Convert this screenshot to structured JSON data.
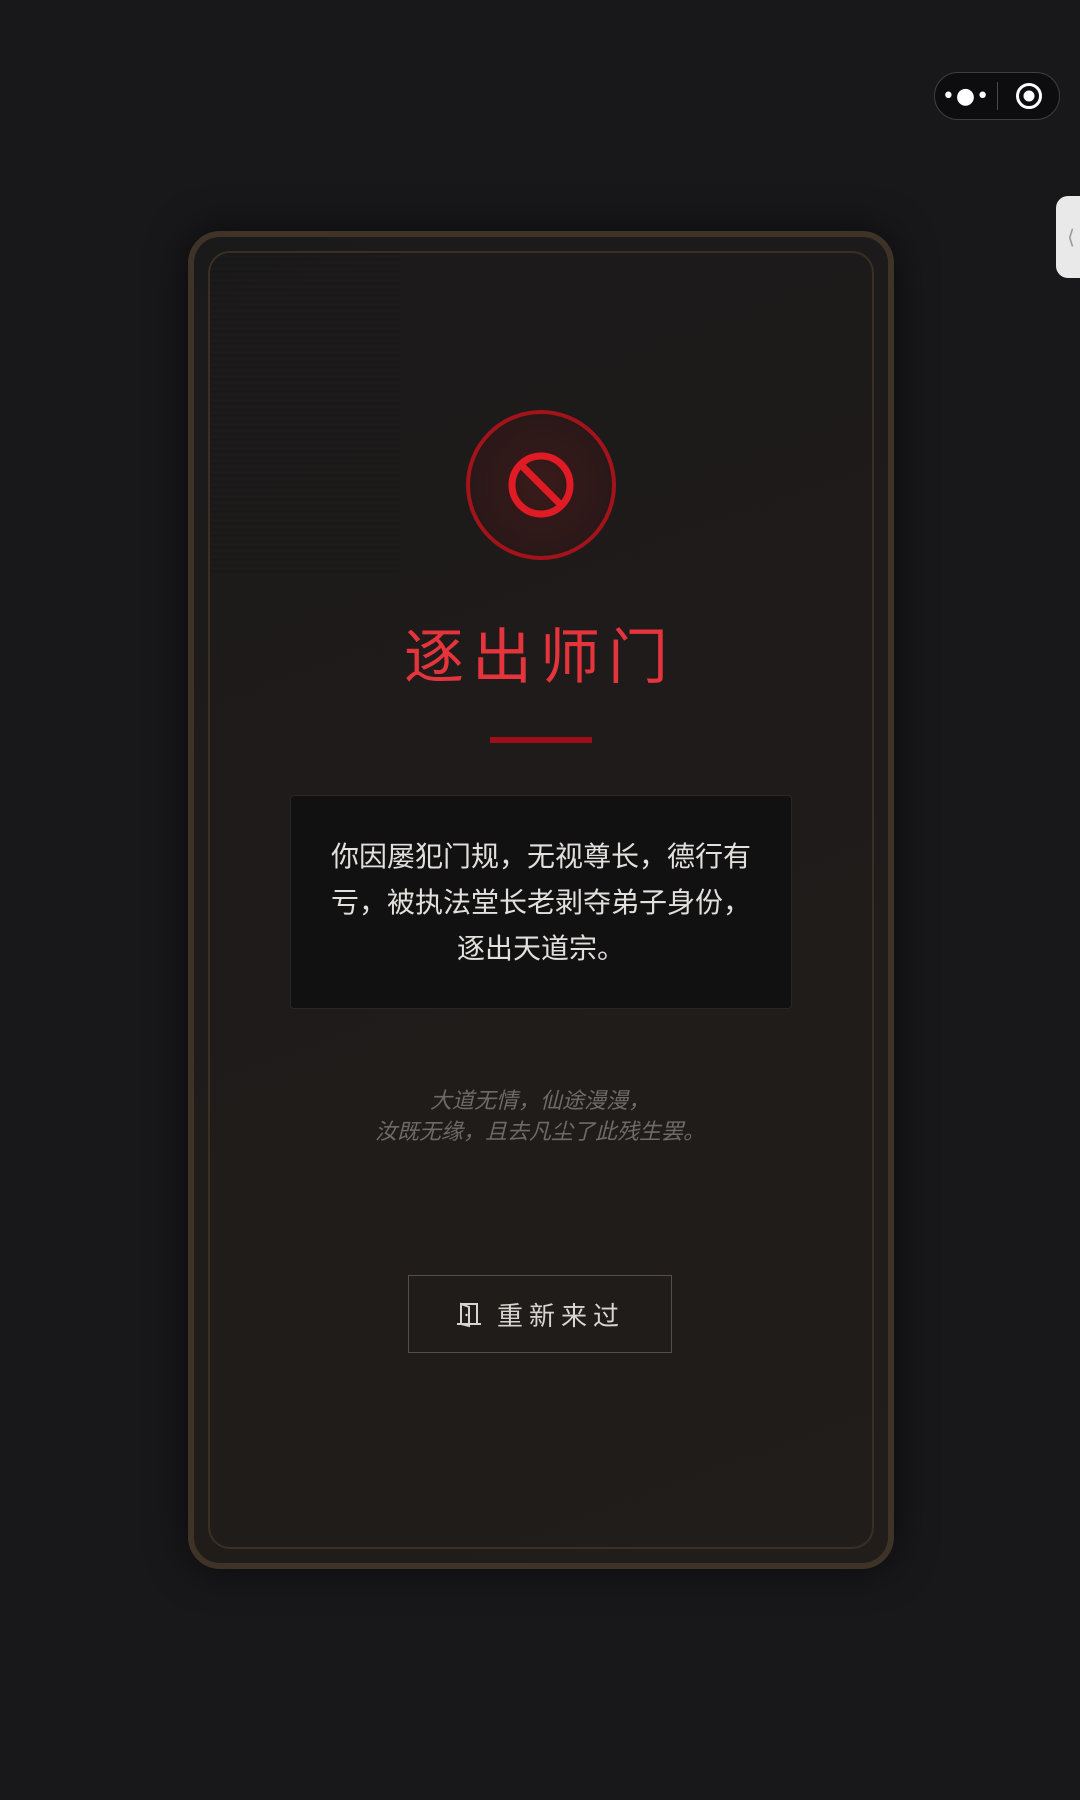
{
  "capsule": {
    "more_label": "•●•"
  },
  "side_tab": {
    "label": "⟨"
  },
  "notice": {
    "title": "逐出师门",
    "message_lines": [
      "你因屡犯门规，无视尊长，德行有",
      "亏，被执法堂长老剥夺弟子身份，",
      "逐出天道宗。"
    ],
    "poem_lines": [
      "大道无情，仙途漫漫，",
      "汝既无缘，且去凡尘了此残生罢。"
    ],
    "restart_label": "重新来过"
  },
  "colors": {
    "accent_red": "#e5343c",
    "dark_red": "#a2131a",
    "card_border": "#3e3326"
  },
  "icons": {
    "ban": "ban-icon",
    "door": "door-icon",
    "target": "target-icon"
  }
}
